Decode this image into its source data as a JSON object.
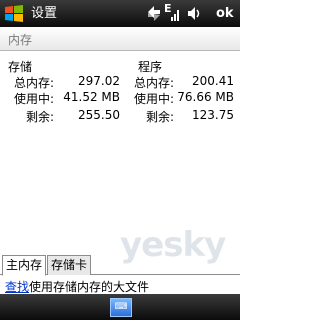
{
  "window": {
    "title": "设置",
    "ok_label": "ok"
  },
  "section": {
    "title": "内存"
  },
  "storage": {
    "title": "存储",
    "rows": [
      {
        "label": "总内存:",
        "value": "297.02"
      },
      {
        "label": "使用中:",
        "value": "41.52 MB"
      },
      {
        "label": "剩余:",
        "value": "255.50"
      }
    ]
  },
  "program": {
    "title": "程序",
    "rows": [
      {
        "label": "总内存:",
        "value": "200.41"
      },
      {
        "label": "使用中:",
        "value": "76.66 MB"
      },
      {
        "label": "剩余:",
        "value": "123.75"
      }
    ]
  },
  "tabs": [
    {
      "label": "主内存",
      "active": true
    },
    {
      "label": "存储卡",
      "active": false
    }
  ],
  "footer": {
    "link_text": "查找",
    "text": "使用存储内存的大文件"
  },
  "status": {
    "e_label": "E"
  },
  "keyboard": {
    "label": "⌨"
  },
  "watermark": {
    "main": "yesky",
    "sub": "天极网"
  }
}
